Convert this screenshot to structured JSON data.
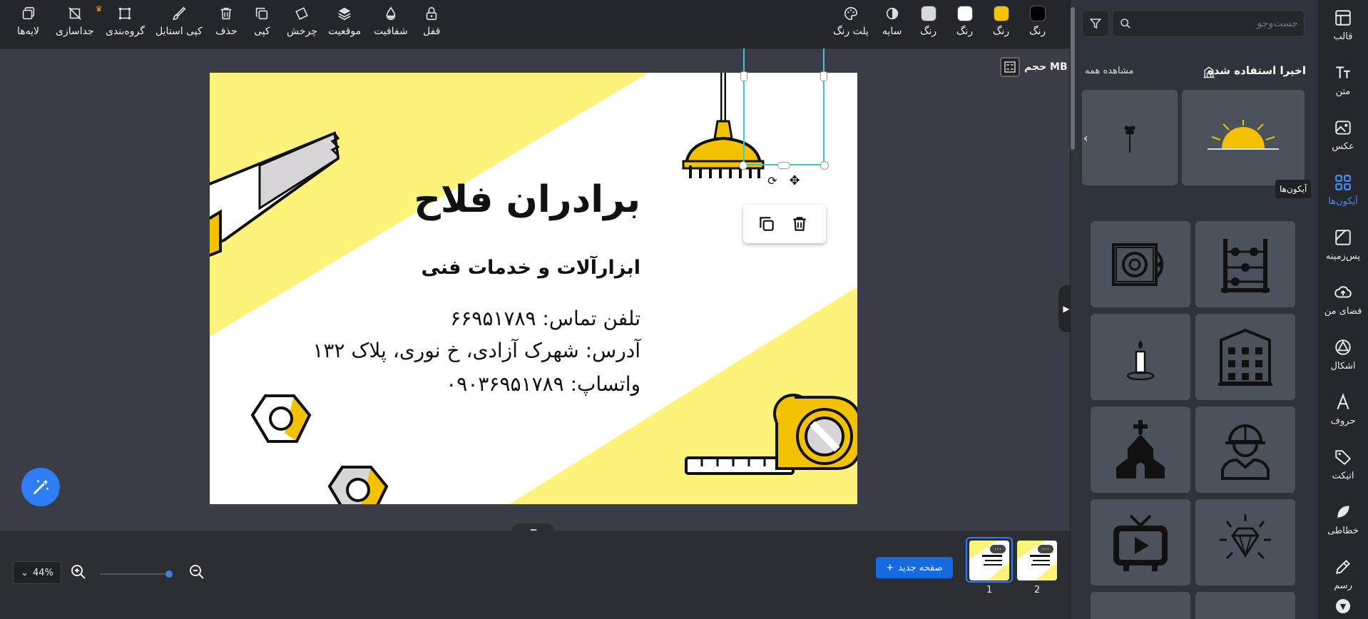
{
  "toolbar": {
    "right": [
      {
        "label": "رنگ",
        "color": "#000000"
      },
      {
        "label": "رنگ",
        "color": "#f6c400"
      },
      {
        "label": "رنگ",
        "color": "#ffffff"
      },
      {
        "label": "رنگ",
        "color": "#d9d9d9"
      },
      {
        "label": "سایه"
      },
      {
        "label": "پلت رنگ"
      }
    ],
    "left": {
      "lock": "قفل",
      "opacity": "شفافیت",
      "position": "موقعیت",
      "rotate": "چرخش",
      "copy": "کپی",
      "delete": "حذف",
      "copy_style": "کپی استایل",
      "group": "گروه‌بندی",
      "ungroup": "جداسازی",
      "layers": "لایه‌ها"
    }
  },
  "canvas": {
    "size_label": "حجم MB",
    "design": {
      "title": "برادران فلاح",
      "subtitle": "ابزارآلات و خدمات فنی",
      "phone": "تلفن تماس: ۶۶۹۵۱۷۸۹",
      "address": "آدرس: شهرک آزادی، خ نوری، پلاک ۱۳۲",
      "whatsapp": "واتساپ: ۰۹۰۳۶۹۵۱۷۸۹"
    }
  },
  "bottom": {
    "zoom": "44%",
    "new_page": "صفحه جدید",
    "pages": [
      "1",
      "2"
    ]
  },
  "panel": {
    "search_placeholder": "جست‌وجو",
    "recent_title": "اخیرا استفاده شده",
    "see_all": "مشاهده همه",
    "tooltip": "آیکون‌ها"
  },
  "rail": [
    "قالب",
    "متن",
    "عکس",
    "آیکون‌ها",
    "پس‌زمینه",
    "فضای من",
    "اشکال",
    "حروف",
    "اتیکت",
    "خطاطی",
    "رسم"
  ],
  "colors": {
    "accent": "#2f7df6",
    "yellow": "#f6c400",
    "card_yellow": "#fdf27a"
  }
}
